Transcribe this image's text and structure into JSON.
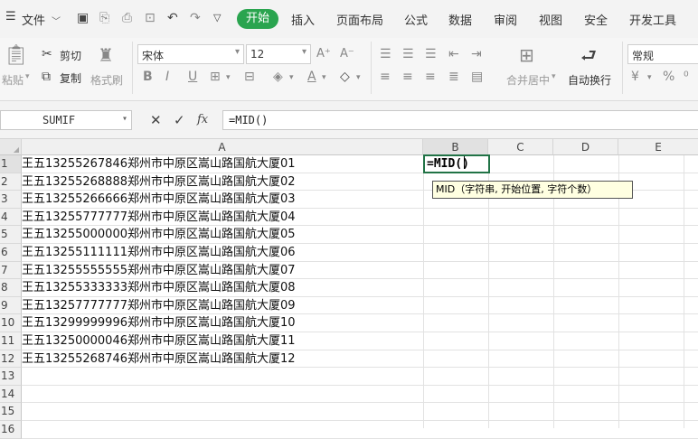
{
  "menubar": {
    "menu_icon": "☰",
    "file_label": "文件",
    "active_tab": "开始",
    "tabs": [
      "插入",
      "页面布局",
      "公式",
      "数据",
      "审阅",
      "视图",
      "安全",
      "开发工具"
    ]
  },
  "ribbon": {
    "paste": "粘贴",
    "cut": "剪切",
    "copy": "复制",
    "format_painter": "格式刷",
    "font_name": "宋体",
    "font_size": "12",
    "merge_center": "合并居中",
    "wrap_text": "自动换行",
    "number_format": "常规"
  },
  "formula_bar": {
    "name_box": "SUMIF",
    "fx": "fx",
    "formula": "=MID()"
  },
  "grid": {
    "columns": [
      "A",
      "B",
      "C",
      "D",
      "E"
    ],
    "rows": [
      "1",
      "2",
      "3",
      "4",
      "5",
      "6",
      "7",
      "8",
      "9",
      "10",
      "11",
      "12",
      "13",
      "14",
      "15",
      "16"
    ],
    "cells_a": [
      "王五13255267846郑州市中原区嵩山路国航大厦01",
      "王五13255268888郑州市中原区嵩山路国航大厦02",
      "王五13255266666郑州市中原区嵩山路国航大厦03",
      "王五13255777777郑州市中原区嵩山路国航大厦04",
      "王五13255000000郑州市中原区嵩山路国航大厦05",
      "王五13255111111郑州市中原区嵩山路国航大厦06",
      "王五13255555555郑州市中原区嵩山路国航大厦07",
      "王五13255333333郑州市中原区嵩山路国航大厦08",
      "王五13257777777郑州市中原区嵩山路国航大厦09",
      "王五13299999996郑州市中原区嵩山路国航大厦10",
      "王五13250000046郑州市中原区嵩山路国航大厦11",
      "王五13255268746郑州市中原区嵩山路国航大厦12"
    ],
    "active_cell_text": "=MID()",
    "tooltip_func": "MID",
    "tooltip_args": "（字符串, 开始位置, 字符个数）"
  },
  "colors": {
    "accent": "#2aa44f",
    "selection": "#217346"
  }
}
